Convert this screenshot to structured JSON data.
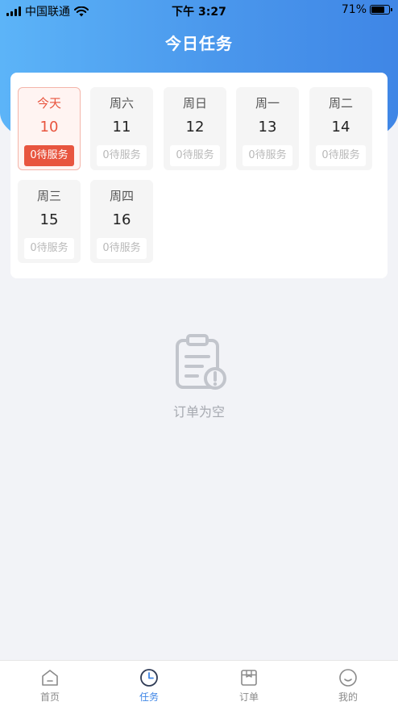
{
  "status_bar": {
    "carrier": "中国联通",
    "time": "下午 3:27",
    "battery_percent": "71%",
    "battery_level": 0.71
  },
  "header": {
    "title": "今日任务"
  },
  "calendar": {
    "days": [
      {
        "weekday": "今天",
        "date": "10",
        "count": "0待服务",
        "selected": true
      },
      {
        "weekday": "周六",
        "date": "11",
        "count": "0待服务",
        "selected": false
      },
      {
        "weekday": "周日",
        "date": "12",
        "count": "0待服务",
        "selected": false
      },
      {
        "weekday": "周一",
        "date": "13",
        "count": "0待服务",
        "selected": false
      },
      {
        "weekday": "周二",
        "date": "14",
        "count": "0待服务",
        "selected": false
      },
      {
        "weekday": "周三",
        "date": "15",
        "count": "0待服务",
        "selected": false
      },
      {
        "weekday": "周四",
        "date": "16",
        "count": "0待服务",
        "selected": false
      }
    ]
  },
  "empty_state": {
    "icon": "clipboard-alert-icon",
    "text": "订单为空"
  },
  "tab_bar": {
    "active_color": "#3f86e6",
    "inactive_color": "#8a8a8a",
    "items": [
      {
        "label": "首页",
        "icon": "home-icon",
        "active": false
      },
      {
        "label": "任务",
        "icon": "clock-icon",
        "active": true
      },
      {
        "label": "订单",
        "icon": "order-box-icon",
        "active": false
      },
      {
        "label": "我的",
        "icon": "profile-smile-icon",
        "active": false
      }
    ]
  },
  "colors": {
    "header_gradient_start": "#5cb4f8",
    "header_gradient_end": "#3f86e6",
    "today_accent": "#e8553f",
    "background": "#f2f3f7"
  }
}
